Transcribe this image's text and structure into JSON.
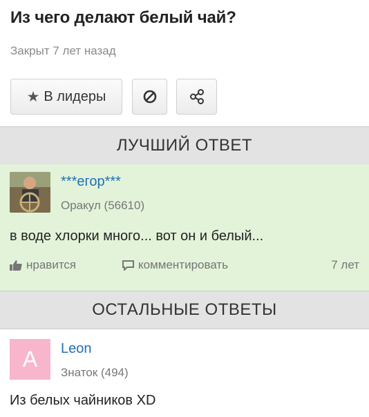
{
  "question": {
    "title": "Из чего делают белый чай?",
    "status": "Закрыт 7 лет назад"
  },
  "actions": {
    "leaders_label": "В лидеры",
    "leaders_icon": "star-icon",
    "block_icon": "block-icon",
    "share_icon": "share-icon"
  },
  "best_answer": {
    "section_title": "ЛУЧШИЙ ОТВЕТ",
    "author": "***егор***",
    "rank": "Оракул (56610)",
    "text": "в воде хлорки много... вот он и белый...",
    "like_label": "нравится",
    "comment_label": "комментировать",
    "time": "7 лет"
  },
  "other_answers": {
    "section_title": "ОСТАЛЬНЫЕ ОТВЕТЫ",
    "items": [
      {
        "avatar_letter": "A",
        "author": "Leon",
        "rank": "Знаток (494)",
        "text": "Из белых чайников XD"
      }
    ]
  },
  "colors": {
    "link": "#1f6fb5",
    "best_bg": "#e2f3d9",
    "section_bg": "#e3e3e3",
    "avatar_pink": "#f8b6cd"
  }
}
